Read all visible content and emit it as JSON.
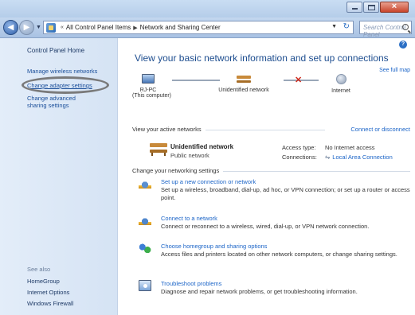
{
  "window": {
    "breadcrumbs": [
      "All Control Panel Items",
      "Network and Sharing Center"
    ],
    "breadcrumb_prefix": "«",
    "search_placeholder": "Search Control Panel"
  },
  "sidebar": {
    "home": "Control Panel Home",
    "links": [
      "Manage wireless networks",
      "Change adapter settings",
      "Change advanced sharing settings"
    ],
    "see_also": "See also",
    "see_also_links": [
      "HomeGroup",
      "Internet Options",
      "Windows Firewall"
    ]
  },
  "main": {
    "title": "View your basic network information and set up connections",
    "see_full_map": "See full map",
    "map": {
      "computer": "RJ-PC",
      "computer_sub": "(This computer)",
      "network": "Unidentified network",
      "internet": "Internet"
    },
    "active_networks_heading": "View your active networks",
    "connect_or_disconnect": "Connect or disconnect",
    "active_network": {
      "name": "Unidentified network",
      "type": "Public network",
      "access_type_label": "Access type:",
      "access_type_value": "No Internet access",
      "connections_label": "Connections:",
      "connections_value": "Local Area Connection"
    },
    "settings_heading": "Change your networking settings",
    "tasks": [
      {
        "link": "Set up a new connection or network",
        "desc": "Set up a wireless, broadband, dial-up, ad hoc, or VPN connection; or set up a router or access point.",
        "icon": "network-setup-icon"
      },
      {
        "link": "Connect to a network",
        "desc": "Connect or reconnect to a wireless, wired, dial-up, or VPN network connection.",
        "icon": "network-connect-icon"
      },
      {
        "link": "Choose homegroup and sharing options",
        "desc": "Access files and printers located on other network computers, or change sharing settings.",
        "icon": "homegroup-icon"
      },
      {
        "link": "Troubleshoot problems",
        "desc": "Diagnose and repair network problems, or get troubleshooting information.",
        "icon": "troubleshoot-icon"
      }
    ]
  },
  "colors": {
    "link": "#1b64c7",
    "title": "#1d4d8f",
    "sidebar_bg": "#dce8f6",
    "error_x": "#d02b1d"
  }
}
